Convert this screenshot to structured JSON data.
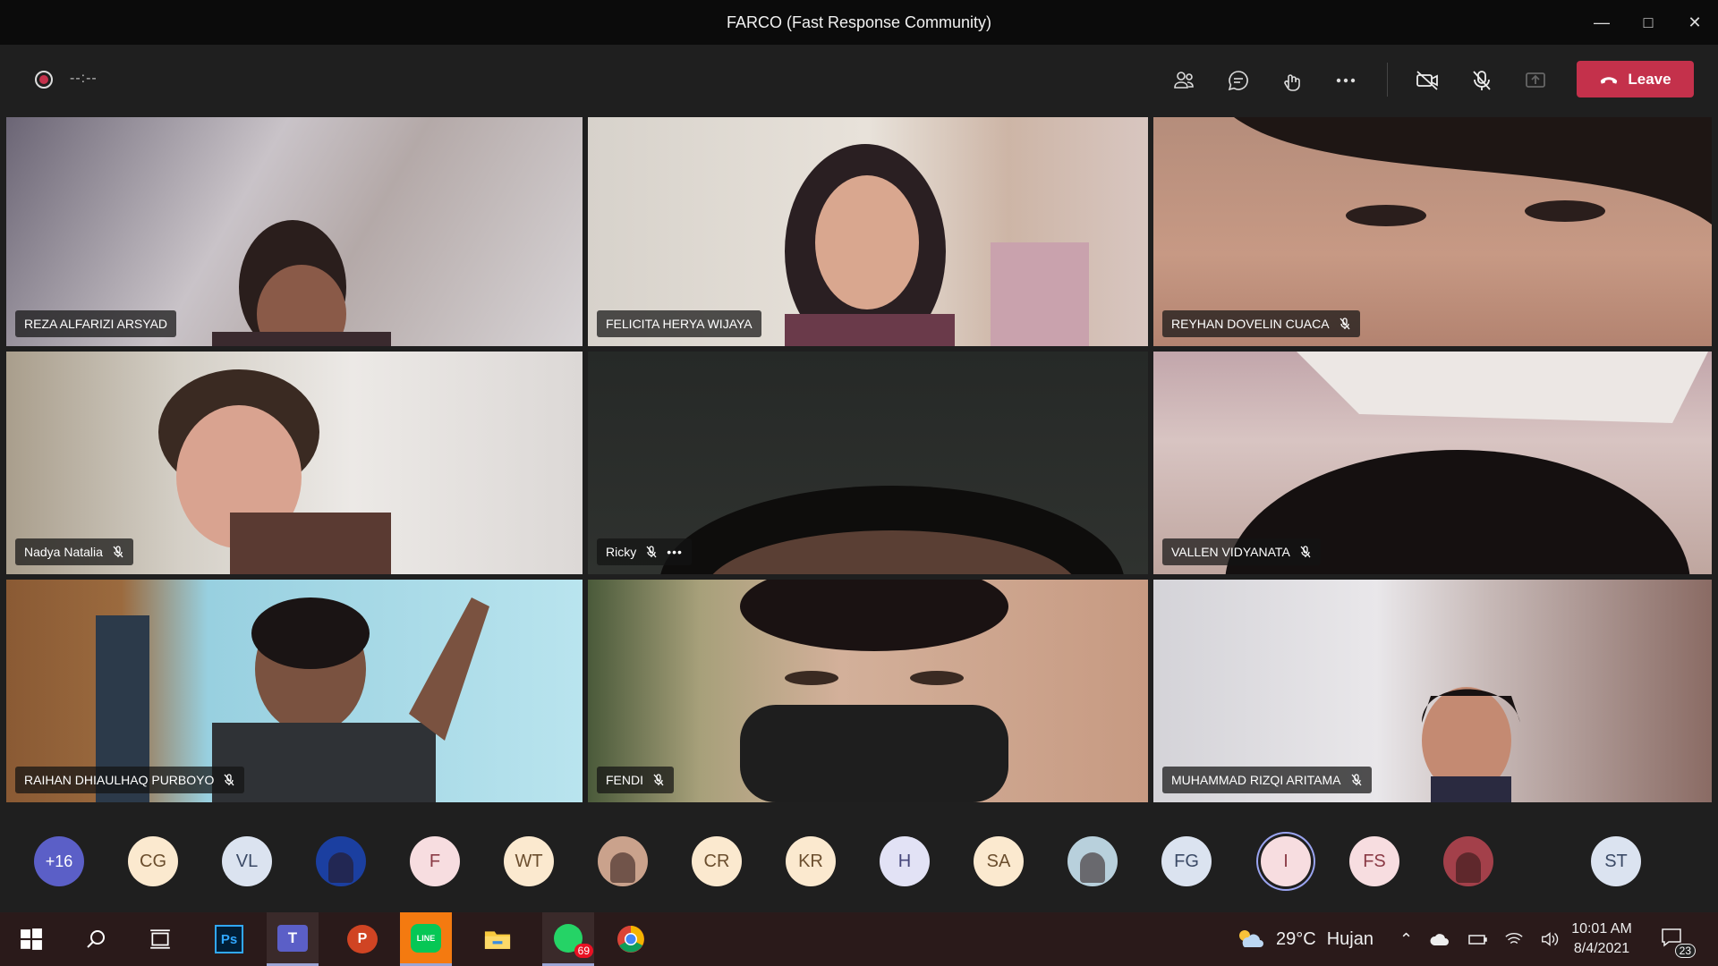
{
  "window": {
    "title": "FARCO (Fast Response Community)",
    "controls": [
      "minimize",
      "maximize",
      "close"
    ]
  },
  "toolbar": {
    "timer": "--:--",
    "leave_label": "Leave",
    "icons": [
      "participants-icon",
      "chat-icon",
      "reactions-icon",
      "more-icon",
      "camera-off-icon",
      "mic-off-icon",
      "share-icon"
    ],
    "colors": {
      "leave": "#c4314b"
    }
  },
  "tiles": [
    {
      "name": "REZA ALFARIZI ARSYAD",
      "muted": false,
      "more": false
    },
    {
      "name": "FELICITA HERYA WIJAYA",
      "muted": false,
      "more": false
    },
    {
      "name": "REYHAN DOVELIN CUACA",
      "muted": true,
      "more": false
    },
    {
      "name": "Nadya Natalia",
      "muted": true,
      "more": false
    },
    {
      "name": "Ricky",
      "muted": true,
      "more": true
    },
    {
      "name": "VALLEN VIDYANATA",
      "muted": true,
      "more": false
    },
    {
      "name": "RAIHAN DHIAULHAQ PURBOYO",
      "muted": true,
      "more": false
    },
    {
      "name": "FENDI",
      "muted": true,
      "more": false
    },
    {
      "name": "MUHAMMAD RIZQI ARITAMA",
      "muted": true,
      "more": false
    }
  ],
  "roster": [
    {
      "initials": "+16",
      "bg": "#5b5fc7",
      "fg": "#ffffff"
    },
    {
      "initials": "CG",
      "bg": "#fbe9cf",
      "fg": "#6b4e2e"
    },
    {
      "initials": "VL",
      "bg": "#dbe3f0",
      "fg": "#3b4a66"
    },
    {
      "initials": "",
      "bg": "#1b3fa0",
      "fg": "#ffffff",
      "photo": true
    },
    {
      "initials": "F",
      "bg": "#f7dde0",
      "fg": "#8a3a45"
    },
    {
      "initials": "WT",
      "bg": "#fbe9cf",
      "fg": "#6b4e2e"
    },
    {
      "initials": "",
      "bg": "#caa28c",
      "fg": "#ffffff",
      "photo": true
    },
    {
      "initials": "CR",
      "bg": "#fbe9cf",
      "fg": "#6b4e2e"
    },
    {
      "initials": "KR",
      "bg": "#fbe9cf",
      "fg": "#6b4e2e"
    },
    {
      "initials": "H",
      "bg": "#e2e2f5",
      "fg": "#46467a"
    },
    {
      "initials": "SA",
      "bg": "#fbe9cf",
      "fg": "#6b4e2e"
    },
    {
      "initials": "",
      "bg": "#b8d0dc",
      "fg": "#ffffff",
      "photo": true
    },
    {
      "initials": "FG",
      "bg": "#dbe3f0",
      "fg": "#3b4a66"
    },
    {
      "initials": "I",
      "bg": "#f7dde0",
      "fg": "#8a3a45",
      "speaking": true
    },
    {
      "initials": "FS",
      "bg": "#f7dde0",
      "fg": "#8a3a45"
    },
    {
      "initials": "",
      "bg": "#a3404a",
      "fg": "#ffffff",
      "photo": true
    },
    {
      "initials": "ST",
      "bg": "#dbe3f0",
      "fg": "#3b4a66"
    }
  ],
  "taskbar": {
    "apps": [
      "windows-start-icon",
      "search-icon",
      "task-view-icon",
      "photoshop-icon",
      "teams-icon",
      "powerpoint-icon",
      "line-icon",
      "file-explorer-icon",
      "whatsapp-icon",
      "chrome-icon"
    ],
    "photoshop_label": "Ps",
    "teams_label": "T",
    "powerpoint_label": "P",
    "line_label": "LINE",
    "whatsapp_badge": "69",
    "weather_temp": "29°C",
    "weather_text": "Hujan",
    "time": "10:01 AM",
    "date": "8/4/2021",
    "notifications": "23"
  }
}
